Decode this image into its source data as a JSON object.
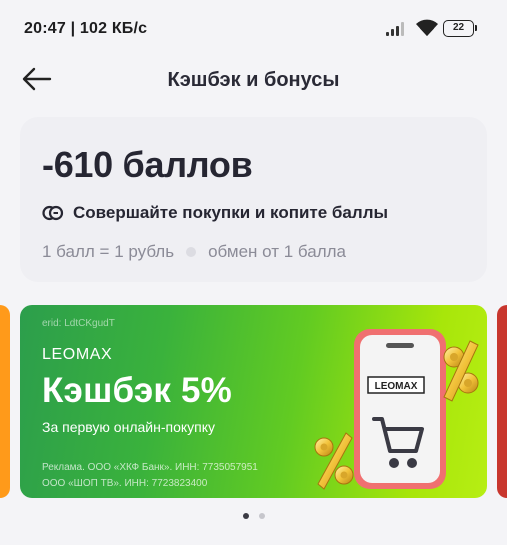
{
  "status_bar": {
    "time_speed": "20:47 | 102 КБ/с",
    "battery": "22"
  },
  "header": {
    "title": "Кэшбэк и бонусы"
  },
  "balance_card": {
    "points": "-610 баллов",
    "hint": "Совершайте покупки и копите баллы",
    "rate": "1 балл = 1 рубль",
    "exchange": "обмен от 1 балла"
  },
  "banner": {
    "erid": "erid: LdtCKgudT",
    "brand": "LEOMAX",
    "offer": "Кэшбэк 5%",
    "offer_sub": "За первую онлайн-покупку",
    "legal_line1": "Реклама. ООО «ХКФ Банк». ИНН: 7735057951",
    "legal_line2": "ООО «ШОП ТВ». ИНН: 7723823400",
    "phone_logo": "LEOMAX",
    "colors": {
      "gradient_start": "#2c9e4c",
      "gradient_end": "#b7ee14"
    }
  },
  "carousel": {
    "pages": 2,
    "active_page": 1,
    "left_peek_color": "#ff9a1a",
    "right_peek_color": "#c8362e"
  },
  "icons": {
    "back": "arrow-left-icon",
    "coin": "coins-icon",
    "signal": "signal-icon",
    "wifi": "wifi-icon",
    "battery": "battery-icon",
    "cart": "cart-icon",
    "percent": "percent-icon"
  }
}
